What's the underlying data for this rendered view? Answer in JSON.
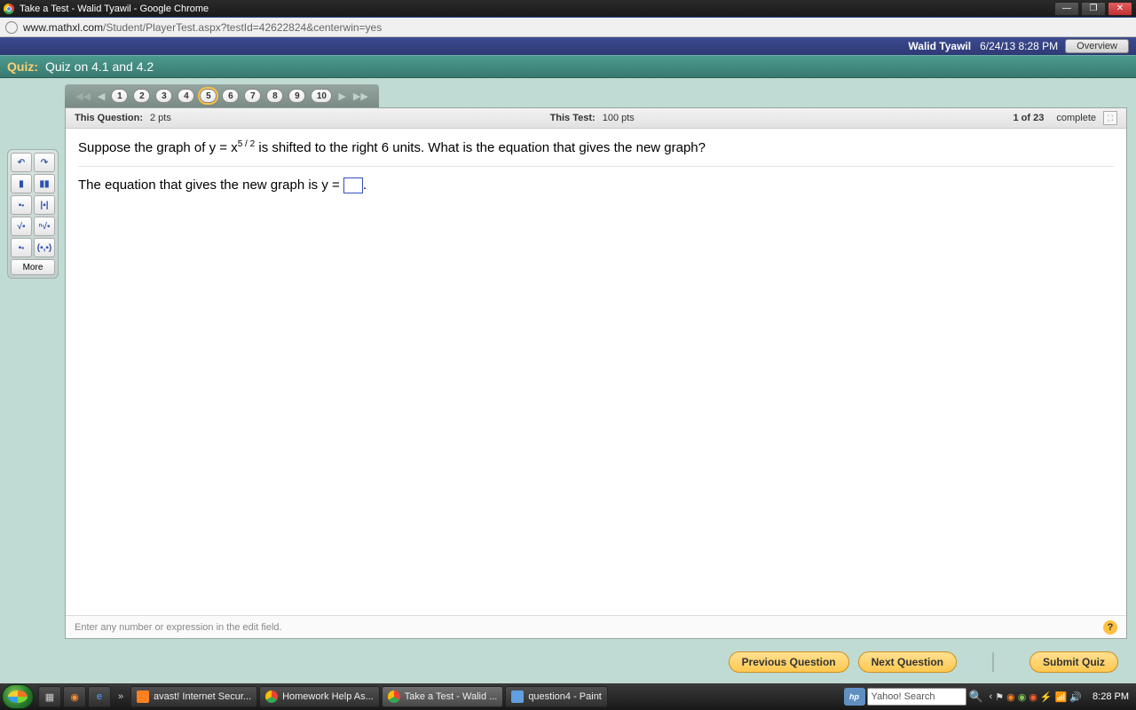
{
  "chrome": {
    "title": "Take a Test - Walid Tyawil - Google Chrome",
    "url_domain": "www.mathxl.com",
    "url_path": "/Student/PlayerTest.aspx?testId=42622824&centerwin=yes"
  },
  "user_bar": {
    "name": "Walid Tyawil",
    "datetime": "6/24/13 8:28 PM",
    "overview": "Overview"
  },
  "quiz_bar": {
    "label": "Quiz:",
    "title": "Quiz on 4.1 and 4.2"
  },
  "qnav": {
    "numbers": [
      "1",
      "2",
      "3",
      "4",
      "5",
      "6",
      "7",
      "8",
      "9",
      "10"
    ],
    "current": "5"
  },
  "qheader": {
    "this_q_label": "This Question:",
    "this_q_pts": "2 pts",
    "this_test_label": "This Test:",
    "this_test_pts": "100 pts",
    "progress": "1 of 23",
    "complete": "complete"
  },
  "question": {
    "prompt_a": "Suppose the graph of y = x",
    "prompt_exp": "5 / 2",
    "prompt_b": " is shifted to the right 6 units. What is the equation that gives the new graph?",
    "answer_lead": "The equation that gives the new graph is y = ",
    "answer_tail": "."
  },
  "footer_hint": "Enter any number or expression in the edit field.",
  "toolbar": {
    "more": "More"
  },
  "buttons": {
    "prev": "Previous Question",
    "next": "Next Question",
    "submit": "Submit Quiz"
  },
  "taskbar": {
    "items": [
      {
        "label": "avast! Internet Secur...",
        "color": "#ff8020"
      },
      {
        "label": "Homework Help As...",
        "color": "#4285f4"
      },
      {
        "label": "Take a Test - Walid ...",
        "color": "#4285f4"
      },
      {
        "label": "question4 - Paint",
        "color": "#60a0e0"
      }
    ],
    "search_placeholder": "Yahoo! Search",
    "time": "8:28 PM",
    "hp": "hp"
  }
}
